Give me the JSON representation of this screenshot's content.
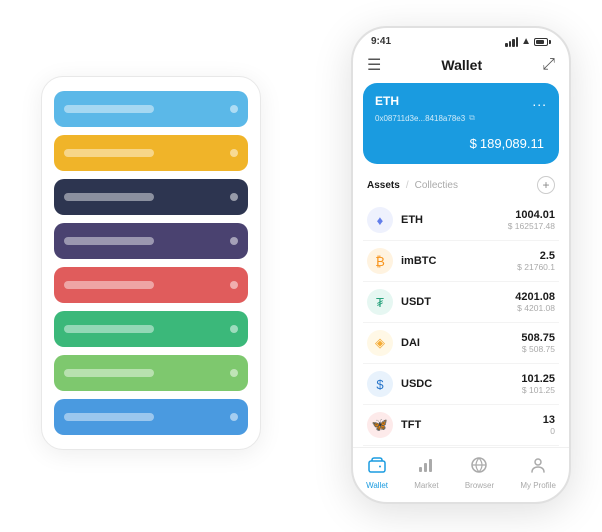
{
  "scene": {
    "cards": [
      {
        "color": "#5bb8e8",
        "dotColor": "rgba(255,255,255,0.5)"
      },
      {
        "color": "#f0b429",
        "dotColor": "rgba(255,255,255,0.5)"
      },
      {
        "color": "#2d3550",
        "dotColor": "rgba(255,255,255,0.5)"
      },
      {
        "color": "#4a4270",
        "dotColor": "rgba(255,255,255,0.5)"
      },
      {
        "color": "#e05c5c",
        "dotColor": "rgba(255,255,255,0.5)"
      },
      {
        "color": "#3bb87a",
        "dotColor": "rgba(255,255,255,0.5)"
      },
      {
        "color": "#7ec86e",
        "dotColor": "rgba(255,255,255,0.5)"
      },
      {
        "color": "#4a9ae0",
        "dotColor": "rgba(255,255,255,0.5)"
      }
    ]
  },
  "phone": {
    "status": {
      "time": "9:41",
      "wifi": "wifi",
      "battery": "battery"
    },
    "header": {
      "menu_icon": "☰",
      "title": "Wallet",
      "expand_icon": "⤢"
    },
    "eth_card": {
      "label": "ETH",
      "dots": "...",
      "address": "0x08711d3e...8418a78e3",
      "copy_icon": "⧉",
      "balance_symbol": "$",
      "balance": "189,089.11"
    },
    "assets_section": {
      "tab_active": "Assets",
      "divider": "/",
      "tab_inactive": "Collecties",
      "add_icon": "+"
    },
    "assets": [
      {
        "icon": "◈",
        "icon_color": "#627eea",
        "bg_color": "#eef1fd",
        "name": "ETH",
        "amount": "1004.01",
        "usd": "$ 162517.48"
      },
      {
        "icon": "₿",
        "icon_color": "#f7931a",
        "bg_color": "#fff3e0",
        "name": "imBTC",
        "amount": "2.5",
        "usd": "$ 21760.1"
      },
      {
        "icon": "₮",
        "icon_color": "#26a17b",
        "bg_color": "#e6f7f2",
        "name": "USDT",
        "amount": "4201.08",
        "usd": "$ 4201.08"
      },
      {
        "icon": "◈",
        "icon_color": "#f5ac37",
        "bg_color": "#fff8e6",
        "name": "DAI",
        "amount": "508.75",
        "usd": "$ 508.75"
      },
      {
        "icon": "◈",
        "icon_color": "#2775ca",
        "bg_color": "#e8f2fc",
        "name": "USDC",
        "amount": "101.25",
        "usd": "$ 101.25"
      },
      {
        "icon": "🦋",
        "icon_color": "#e05c5c",
        "bg_color": "#fdeaea",
        "name": "TFT",
        "amount": "13",
        "usd": "0"
      }
    ],
    "nav": [
      {
        "icon": "👛",
        "label": "Wallet",
        "active": true
      },
      {
        "icon": "📈",
        "label": "Market",
        "active": false
      },
      {
        "icon": "🌐",
        "label": "Browser",
        "active": false
      },
      {
        "icon": "👤",
        "label": "My Profile",
        "active": false
      }
    ]
  }
}
